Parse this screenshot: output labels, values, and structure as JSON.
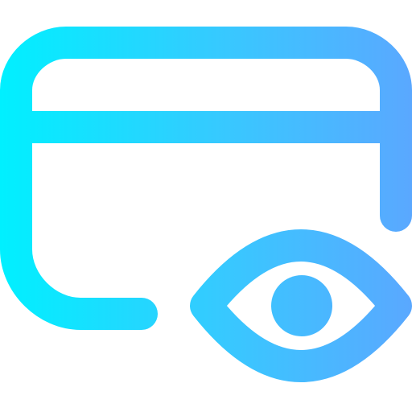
{
  "icon": {
    "name": "credit-card-eye-icon",
    "description_parts": [
      "card-outline",
      "card-stripe",
      "eye-outline",
      "eye-pupil"
    ],
    "gradient": {
      "start_color": "#00F0FF",
      "mid_color": "#38C8FF",
      "end_color": "#5AA8FF"
    }
  }
}
